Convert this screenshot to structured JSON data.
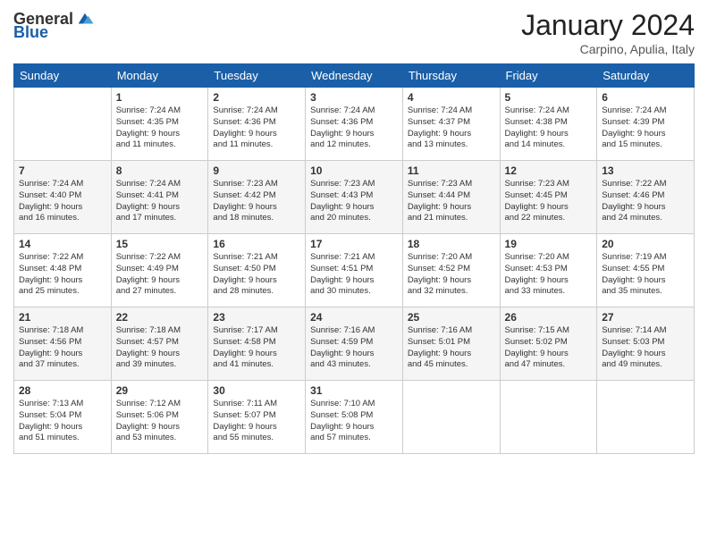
{
  "logo": {
    "text_general": "General",
    "text_blue": "Blue"
  },
  "header": {
    "month": "January 2024",
    "location": "Carpino, Apulia, Italy"
  },
  "weekdays": [
    "Sunday",
    "Monday",
    "Tuesday",
    "Wednesday",
    "Thursday",
    "Friday",
    "Saturday"
  ],
  "weeks": [
    [
      {
        "day": "",
        "info": ""
      },
      {
        "day": "1",
        "info": "Sunrise: 7:24 AM\nSunset: 4:35 PM\nDaylight: 9 hours\nand 11 minutes."
      },
      {
        "day": "2",
        "info": "Sunrise: 7:24 AM\nSunset: 4:36 PM\nDaylight: 9 hours\nand 11 minutes."
      },
      {
        "day": "3",
        "info": "Sunrise: 7:24 AM\nSunset: 4:36 PM\nDaylight: 9 hours\nand 12 minutes."
      },
      {
        "day": "4",
        "info": "Sunrise: 7:24 AM\nSunset: 4:37 PM\nDaylight: 9 hours\nand 13 minutes."
      },
      {
        "day": "5",
        "info": "Sunrise: 7:24 AM\nSunset: 4:38 PM\nDaylight: 9 hours\nand 14 minutes."
      },
      {
        "day": "6",
        "info": "Sunrise: 7:24 AM\nSunset: 4:39 PM\nDaylight: 9 hours\nand 15 minutes."
      }
    ],
    [
      {
        "day": "7",
        "info": "Sunrise: 7:24 AM\nSunset: 4:40 PM\nDaylight: 9 hours\nand 16 minutes."
      },
      {
        "day": "8",
        "info": "Sunrise: 7:24 AM\nSunset: 4:41 PM\nDaylight: 9 hours\nand 17 minutes."
      },
      {
        "day": "9",
        "info": "Sunrise: 7:23 AM\nSunset: 4:42 PM\nDaylight: 9 hours\nand 18 minutes."
      },
      {
        "day": "10",
        "info": "Sunrise: 7:23 AM\nSunset: 4:43 PM\nDaylight: 9 hours\nand 20 minutes."
      },
      {
        "day": "11",
        "info": "Sunrise: 7:23 AM\nSunset: 4:44 PM\nDaylight: 9 hours\nand 21 minutes."
      },
      {
        "day": "12",
        "info": "Sunrise: 7:23 AM\nSunset: 4:45 PM\nDaylight: 9 hours\nand 22 minutes."
      },
      {
        "day": "13",
        "info": "Sunrise: 7:22 AM\nSunset: 4:46 PM\nDaylight: 9 hours\nand 24 minutes."
      }
    ],
    [
      {
        "day": "14",
        "info": "Sunrise: 7:22 AM\nSunset: 4:48 PM\nDaylight: 9 hours\nand 25 minutes."
      },
      {
        "day": "15",
        "info": "Sunrise: 7:22 AM\nSunset: 4:49 PM\nDaylight: 9 hours\nand 27 minutes."
      },
      {
        "day": "16",
        "info": "Sunrise: 7:21 AM\nSunset: 4:50 PM\nDaylight: 9 hours\nand 28 minutes."
      },
      {
        "day": "17",
        "info": "Sunrise: 7:21 AM\nSunset: 4:51 PM\nDaylight: 9 hours\nand 30 minutes."
      },
      {
        "day": "18",
        "info": "Sunrise: 7:20 AM\nSunset: 4:52 PM\nDaylight: 9 hours\nand 32 minutes."
      },
      {
        "day": "19",
        "info": "Sunrise: 7:20 AM\nSunset: 4:53 PM\nDaylight: 9 hours\nand 33 minutes."
      },
      {
        "day": "20",
        "info": "Sunrise: 7:19 AM\nSunset: 4:55 PM\nDaylight: 9 hours\nand 35 minutes."
      }
    ],
    [
      {
        "day": "21",
        "info": "Sunrise: 7:18 AM\nSunset: 4:56 PM\nDaylight: 9 hours\nand 37 minutes."
      },
      {
        "day": "22",
        "info": "Sunrise: 7:18 AM\nSunset: 4:57 PM\nDaylight: 9 hours\nand 39 minutes."
      },
      {
        "day": "23",
        "info": "Sunrise: 7:17 AM\nSunset: 4:58 PM\nDaylight: 9 hours\nand 41 minutes."
      },
      {
        "day": "24",
        "info": "Sunrise: 7:16 AM\nSunset: 4:59 PM\nDaylight: 9 hours\nand 43 minutes."
      },
      {
        "day": "25",
        "info": "Sunrise: 7:16 AM\nSunset: 5:01 PM\nDaylight: 9 hours\nand 45 minutes."
      },
      {
        "day": "26",
        "info": "Sunrise: 7:15 AM\nSunset: 5:02 PM\nDaylight: 9 hours\nand 47 minutes."
      },
      {
        "day": "27",
        "info": "Sunrise: 7:14 AM\nSunset: 5:03 PM\nDaylight: 9 hours\nand 49 minutes."
      }
    ],
    [
      {
        "day": "28",
        "info": "Sunrise: 7:13 AM\nSunset: 5:04 PM\nDaylight: 9 hours\nand 51 minutes."
      },
      {
        "day": "29",
        "info": "Sunrise: 7:12 AM\nSunset: 5:06 PM\nDaylight: 9 hours\nand 53 minutes."
      },
      {
        "day": "30",
        "info": "Sunrise: 7:11 AM\nSunset: 5:07 PM\nDaylight: 9 hours\nand 55 minutes."
      },
      {
        "day": "31",
        "info": "Sunrise: 7:10 AM\nSunset: 5:08 PM\nDaylight: 9 hours\nand 57 minutes."
      },
      {
        "day": "",
        "info": ""
      },
      {
        "day": "",
        "info": ""
      },
      {
        "day": "",
        "info": ""
      }
    ]
  ]
}
